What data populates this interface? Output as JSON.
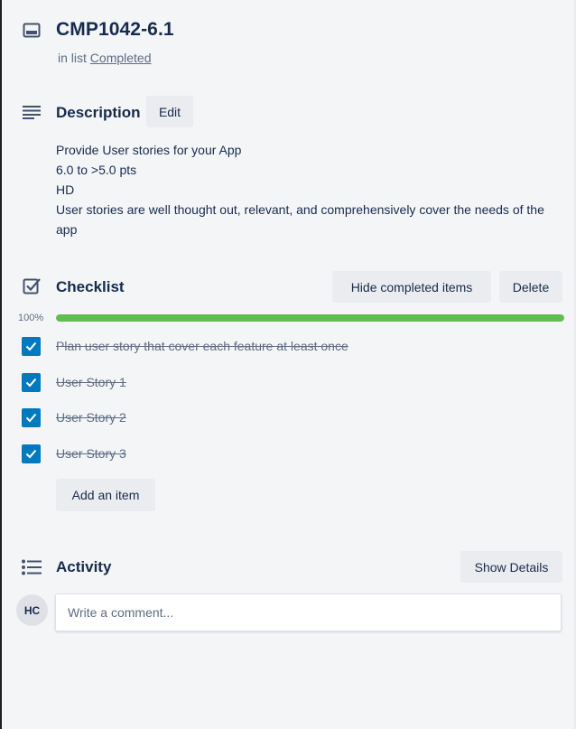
{
  "card": {
    "title": "CMP1042-6.1",
    "in_list_prefix": "in list",
    "list_name": "Completed"
  },
  "description": {
    "heading": "Description",
    "edit_label": "Edit",
    "lines": [
      "Provide User stories for your App",
      "6.0 to >5.0 pts",
      "HD",
      "User stories are well thought out, relevant, and comprehensively cover the needs of the app"
    ]
  },
  "checklist": {
    "heading": "Checklist",
    "hide_completed_label": "Hide completed items",
    "delete_label": "Delete",
    "progress_label": "100%",
    "progress_fraction": 1.0,
    "items": [
      {
        "text": "Plan user story that cover each feature at least once",
        "checked": true
      },
      {
        "text": "User Story 1",
        "checked": true
      },
      {
        "text": "User Story 2",
        "checked": true
      },
      {
        "text": "User Story 3",
        "checked": true
      }
    ],
    "add_item_label": "Add an item"
  },
  "activity": {
    "heading": "Activity",
    "show_details_label": "Show Details",
    "avatar_initials": "HC",
    "comment_placeholder": "Write a comment..."
  },
  "colors": {
    "accent": "#0079bf",
    "progress": "#61bd4f",
    "background": "#f4f5f7",
    "button_bg": "#ebecf0",
    "text": "#172b4d",
    "muted_text": "#5e6c84"
  },
  "icons": {
    "card": "card-icon",
    "description": "description-icon",
    "checklist": "checklist-icon",
    "activity": "activity-icon",
    "checkmark": "checkmark-icon"
  }
}
